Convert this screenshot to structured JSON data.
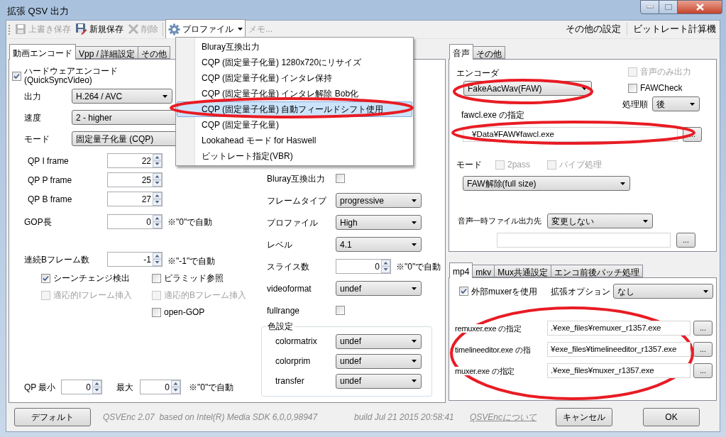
{
  "window": {
    "title": "拡張 QSV 出力"
  },
  "toolbar": {
    "buttons": [
      {
        "kind": "button",
        "label": "上書き保存",
        "disabled": true
      },
      {
        "kind": "button",
        "label": "新規保存",
        "disabled": false
      },
      {
        "kind": "button",
        "label": "削除",
        "disabled": true
      },
      {
        "kind": "menu",
        "label": "プロファイル",
        "open": true
      }
    ],
    "memo": {
      "placeholder": "メモ..."
    },
    "links": [
      {
        "label": "その他の設定"
      },
      {
        "label": "ビットレート計算機"
      }
    ]
  },
  "profile_menu": {
    "items": [
      {
        "label": "Bluray互換出力",
        "selected": false
      },
      {
        "label": "CQP (固定量子化量) 1280x720にリサイズ",
        "selected": false
      },
      {
        "label": "CQP (固定量子化量) インタレ保持",
        "selected": false
      },
      {
        "label": "CQP (固定量子化量) インタレ解除 Bob化",
        "selected": false
      },
      {
        "label": "CQP (固定量子化量) 自動フィールドシフト使用",
        "selected": true
      },
      {
        "label": "CQP (固定量子化量)",
        "selected": false
      },
      {
        "label": "Lookahead モード for Haswell",
        "selected": false
      },
      {
        "label": "ビットレート指定(VBR)",
        "selected": false
      }
    ]
  },
  "video_tabs": [
    {
      "label": "動画エンコード",
      "selected": true
    },
    {
      "label": "Vpp / 詳細設定",
      "selected": false
    },
    {
      "label": "その他",
      "selected": false
    }
  ],
  "video": {
    "hw_encode": {
      "label": "ハードウェアエンコード (QuickSyncVideo)",
      "checked": true
    },
    "output": {
      "label": "出力",
      "value": "H.264 / AVC"
    },
    "speed": {
      "label": "速度",
      "value": "2 - higher"
    },
    "mode": {
      "label": "モード",
      "value": "固定量子化量 (CQP)"
    },
    "qp": [
      {
        "label": "QP I frame",
        "value": "22"
      },
      {
        "label": "QP P frame",
        "value": "25"
      },
      {
        "label": "QP B frame",
        "value": "27"
      }
    ],
    "gop": {
      "label": "GOP長",
      "value": "0",
      "note": "※\"0\"で自動"
    },
    "bframes": {
      "label": "連続Bフレーム数",
      "value": "-1",
      "note": "※\"-1\"で自動"
    },
    "options": [
      {
        "label": "シーンチェンジ検出",
        "checked": true,
        "disabled": false
      },
      {
        "label": "ピラミッド参照",
        "checked": false,
        "disabled": false
      },
      {
        "label": "適応的Iフレーム挿入",
        "checked": false,
        "disabled": true
      },
      {
        "label": "適応的Bフレーム挿入",
        "checked": false,
        "disabled": true
      },
      {
        "label": "open-GOP",
        "checked": false,
        "disabled": false
      }
    ],
    "qp_range": {
      "min_label": "QP 最小",
      "min": "0",
      "max_label": "最大",
      "max": "0",
      "note": "※\"0\"で自動"
    },
    "settings": [
      {
        "kind": "checkbox",
        "label": "Bluray互換出力",
        "checked": false
      },
      {
        "kind": "select",
        "label": "フレームタイプ",
        "value": "progressive"
      },
      {
        "kind": "select",
        "label": "プロファイル",
        "value": "High"
      },
      {
        "kind": "select",
        "label": "レベル",
        "value": "4.1"
      },
      {
        "kind": "spin",
        "label": "スライス数",
        "value": "0",
        "note": "※\"0\"で自動"
      },
      {
        "kind": "select",
        "label": "videoformat",
        "value": "undef"
      },
      {
        "kind": "checkbox",
        "label": "fullrange",
        "checked": false
      }
    ],
    "color_group": {
      "title": "色設定",
      "rows": [
        {
          "label": "colormatrix",
          "value": "undef"
        },
        {
          "label": "colorprim",
          "value": "undef"
        },
        {
          "label": "transfer",
          "value": "undef"
        }
      ]
    }
  },
  "audio_tabs": [
    {
      "label": "音声",
      "selected": true
    },
    {
      "label": "その他",
      "selected": false
    }
  ],
  "audio": {
    "encoder_label": "エンコーダ",
    "encoder": "FakeAacWav(FAW)",
    "audio_only": {
      "label": "音声のみ出力",
      "checked": false,
      "disabled": true
    },
    "faw_check": {
      "label": "FAWCheck",
      "checked": false,
      "disabled": false
    },
    "order_label": "処理順",
    "order": "後",
    "path_label": "fawcl.exe の指定",
    "path": "¥Data¥FAW¥fawcl.exe",
    "path_browse": "...",
    "mode_label": "モード",
    "two_pass": {
      "label": "2pass",
      "checked": false,
      "disabled": true
    },
    "pipe": {
      "label": "パイプ処理",
      "checked": false,
      "disabled": true
    },
    "mode": "FAW解除(full size)",
    "temp_label": "音声一時ファイル出力先",
    "temp": "変更しない",
    "temp_browse": "..."
  },
  "mux_tabs": [
    {
      "label": "mp4",
      "selected": true
    },
    {
      "label": "mkv",
      "selected": false
    },
    {
      "label": "Mux共通設定",
      "selected": false
    },
    {
      "label": "エンコ前後バッチ処理",
      "selected": false
    }
  ],
  "mux": {
    "external": {
      "label": "外部muxerを使用",
      "checked": true
    },
    "ext_label": "拡張オプション",
    "ext": "なし",
    "paths": [
      {
        "label": "remuxer.exe の指定",
        "value": ".¥exe_files¥remuxer_r1357.exe",
        "browse": "..."
      },
      {
        "label": "timelineeditor.exe の指",
        "value": "¥exe_files¥timelineeditor_r1357.exe",
        "browse": "..."
      },
      {
        "label": "muxer.exe の指定",
        "value": ".¥exe_files¥muxer_r1357.exe",
        "browse": "..."
      }
    ]
  },
  "footer": {
    "default_button": "デフォルト",
    "version": "QSVEnc 2.07  based on Intel(R) Media SDK 6,0,0,98947",
    "build": "build Jul 21 2015 20:58:41",
    "about_link": "QSVEncについて",
    "cancel": "キャンセル",
    "ok": "OK"
  }
}
